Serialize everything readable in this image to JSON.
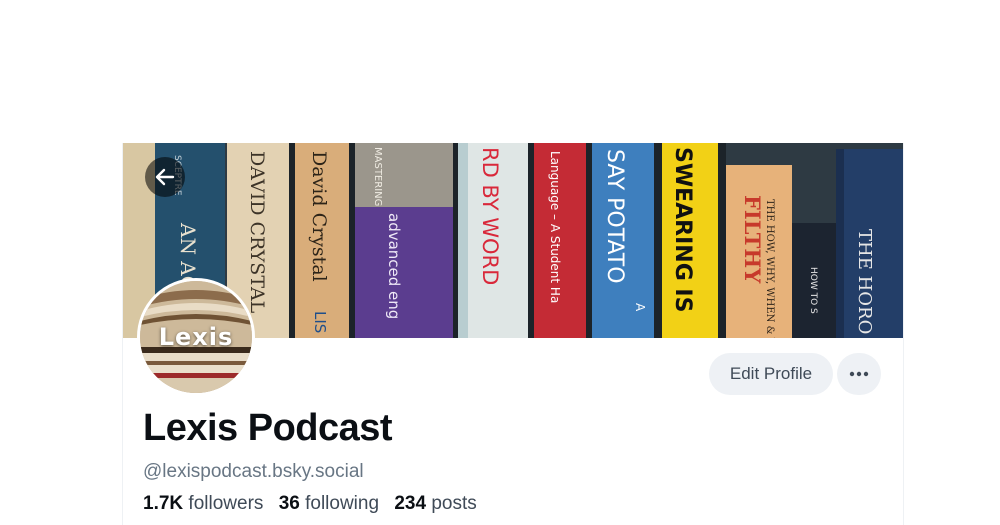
{
  "profile": {
    "display_name": "Lexis Podcast",
    "handle": "@lexispodcast.bsky.social",
    "avatar_text": "Lexis",
    "stats": {
      "followers_count": "1.7K",
      "followers_label": "followers",
      "following_count": "36",
      "following_label": "following",
      "posts_count": "234",
      "posts_label": "posts"
    }
  },
  "actions": {
    "edit_profile_label": "Edit Profile"
  },
  "banner": {
    "book_spines": [
      "SCEPTRE",
      "AN AGG",
      "DAVID CRYSTAL",
      "David Crystal",
      "LIS",
      "MASTERING",
      "advanced eng",
      "RD BY WORD",
      "Language – A Student Ha",
      "SAY POTATO",
      "A",
      "SWEARING IS",
      "FILTHY",
      "THE HOW, WHY, WHEN & W",
      "HOW TO S",
      "THE HORO"
    ]
  },
  "icons": {
    "back": "arrow-left-icon",
    "more": "ellipsis-icon"
  },
  "colors": {
    "button_bg": "#eef1f5",
    "secondary_text": "#687684",
    "primary_text": "#0b0f14"
  }
}
